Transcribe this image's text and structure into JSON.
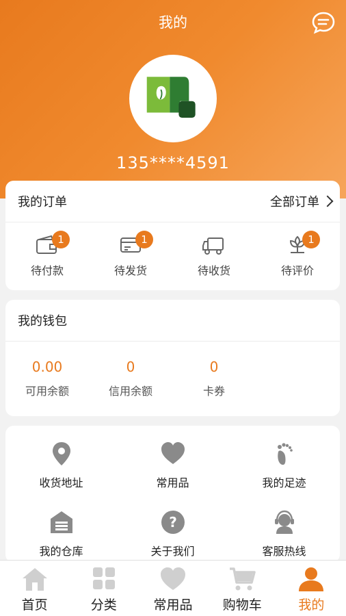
{
  "header": {
    "title": "我的",
    "message_icon": "chat-bubble-icon"
  },
  "profile": {
    "avatar_icon": "app-logo",
    "phone": "135****4591"
  },
  "orders": {
    "title": "我的订单",
    "all_label": "全部订单",
    "items": [
      {
        "label": "待付款",
        "icon": "wallet-icon",
        "badge": "1"
      },
      {
        "label": "待发货",
        "icon": "card-icon",
        "badge": "1"
      },
      {
        "label": "待收货",
        "icon": "truck-icon",
        "badge": ""
      },
      {
        "label": "待评价",
        "icon": "flower-icon",
        "badge": "1"
      }
    ]
  },
  "wallet": {
    "title": "我的钱包",
    "items": [
      {
        "value": "0.00",
        "label": "可用余额"
      },
      {
        "value": "0",
        "label": "信用余额"
      },
      {
        "value": "0",
        "label": "卡券"
      }
    ]
  },
  "tools": [
    {
      "label": "收货地址",
      "icon": "location-pin-icon"
    },
    {
      "label": "常用品",
      "icon": "heart-icon"
    },
    {
      "label": "我的足迹",
      "icon": "footprint-icon"
    },
    {
      "label": "我的仓库",
      "icon": "warehouse-icon"
    },
    {
      "label": "关于我们",
      "icon": "question-icon"
    },
    {
      "label": "客服热线",
      "icon": "headset-icon"
    }
  ],
  "tabbar": [
    {
      "label": "首页",
      "icon": "home-icon",
      "active": false
    },
    {
      "label": "分类",
      "icon": "grid-icon",
      "active": false
    },
    {
      "label": "常用品",
      "icon": "heart-icon",
      "active": false
    },
    {
      "label": "购物车",
      "icon": "cart-icon",
      "active": false
    },
    {
      "label": "我的",
      "icon": "person-icon",
      "active": true
    }
  ],
  "colors": {
    "accent": "#e87a1e",
    "icon_gray": "#8a8a8a",
    "tab_gray": "#cfcfcf"
  }
}
